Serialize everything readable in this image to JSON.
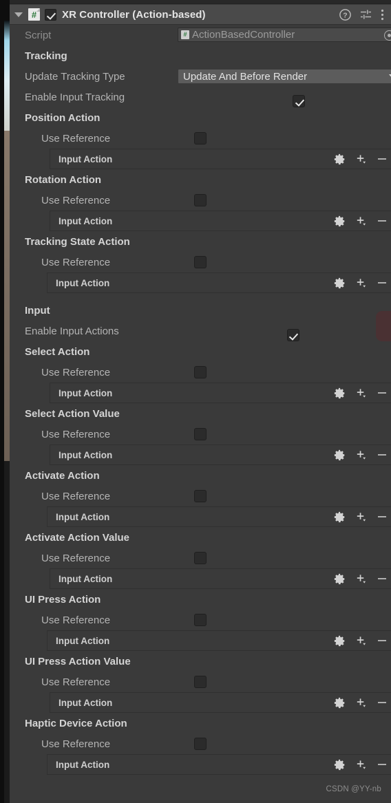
{
  "window": {
    "background_color": "#3a3a3a",
    "panel_color": "#3a3a3a",
    "header_color": "#4a4a4a"
  },
  "component_header": {
    "foldout_icon": "triangle-down-icon",
    "script_icon": "csharp-script-icon",
    "script_icon_glyph": "#",
    "enabled": true,
    "title": "XR Controller (Action-based)",
    "icons": [
      {
        "name": "help-icon",
        "label": "?"
      },
      {
        "name": "preset-icon",
        "label": "preset"
      },
      {
        "name": "more-menu-icon",
        "label": "⋮"
      }
    ]
  },
  "script_row": {
    "label": "Script",
    "value": "ActionBasedController",
    "icon": "csharp-script-icon",
    "icon_glyph": "#",
    "picker_icon": "object-picker-icon"
  },
  "tracking_section": {
    "title": "Tracking",
    "update_tracking_type": {
      "label": "Update Tracking Type",
      "value": "Update And Before Render",
      "arrow_icon": "chevron-down-icon"
    },
    "enable_input_tracking": {
      "label": "Enable Input Tracking",
      "checked": true
    }
  },
  "input_section": {
    "title": "Input",
    "enable_input_actions": {
      "label": "Enable Input Actions",
      "checked": true
    }
  },
  "common": {
    "use_reference_label": "Use Reference",
    "use_reference_checked": false,
    "input_action_label": "Input Action",
    "tool_icons": [
      {
        "name": "gear-icon"
      },
      {
        "name": "plus-dropdown-icon"
      },
      {
        "name": "minus-icon"
      }
    ]
  },
  "action_groups": [
    {
      "title": "Position Action",
      "use_reference": "Use Reference",
      "checked": false,
      "field_label": "Input Action",
      "group": "tracking"
    },
    {
      "title": "Rotation Action",
      "use_reference": "Use Reference",
      "checked": false,
      "field_label": "Input Action",
      "group": "tracking"
    },
    {
      "title": "Tracking State Action",
      "use_reference": "Use Reference",
      "checked": false,
      "field_label": "Input Action",
      "group": "tracking"
    },
    {
      "title": "Select Action",
      "use_reference": "Use Reference",
      "checked": false,
      "field_label": "Input Action",
      "group": "input"
    },
    {
      "title": "Select Action Value",
      "use_reference": "Use Reference",
      "checked": false,
      "field_label": "Input Action",
      "group": "input"
    },
    {
      "title": "Activate Action",
      "use_reference": "Use Reference",
      "checked": false,
      "field_label": "Input Action",
      "group": "input"
    },
    {
      "title": "Activate Action Value",
      "use_reference": "Use Reference",
      "checked": false,
      "field_label": "Input Action",
      "group": "input"
    },
    {
      "title": "UI Press Action",
      "use_reference": "Use Reference",
      "checked": false,
      "field_label": "Input Action",
      "group": "input"
    },
    {
      "title": "UI Press Action Value",
      "use_reference": "Use Reference",
      "checked": false,
      "field_label": "Input Action",
      "group": "input"
    },
    {
      "title": "Haptic Device Action",
      "use_reference": "Use Reference",
      "checked": false,
      "field_label": "Input Action",
      "group": "input"
    }
  ],
  "watermark": {
    "text": "CSDN @YY-nb"
  }
}
